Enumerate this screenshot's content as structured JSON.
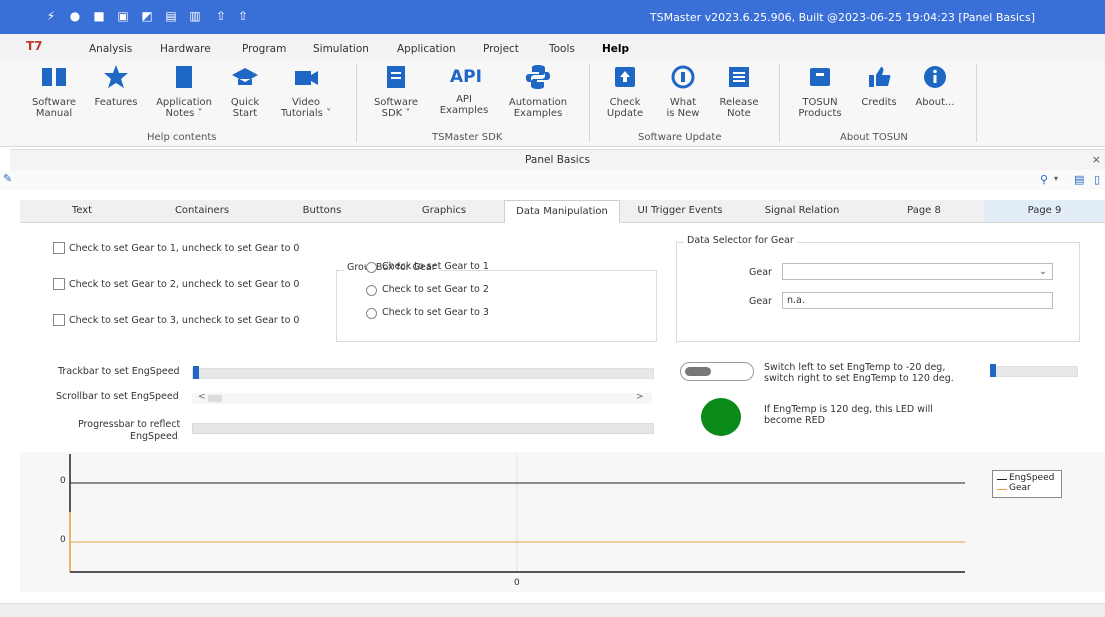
{
  "window": {
    "title": "TSMaster v2023.6.25.906, Built @2023-06-25 19:04:23 [Panel Basics]"
  },
  "menu": [
    "Analysis",
    "Hardware",
    "Program",
    "Simulation",
    "Application",
    "Project",
    "Tools",
    "Help"
  ],
  "ribbon": {
    "groups": [
      {
        "label": "Help contents",
        "buttons": [
          "Software\nManual",
          "Features",
          "Application\nNotes ˅",
          "Quick\nStart",
          "Video\nTutorials ˅"
        ]
      },
      {
        "label": "TSMaster SDK",
        "buttons": [
          "Software\nSDK ˅",
          "API\nExamples",
          "Automation\nExamples"
        ]
      },
      {
        "label": "Software Update",
        "buttons": [
          "Check\nUpdate",
          "What\nis New",
          "Release\nNote"
        ]
      },
      {
        "label": "About TOSUN",
        "buttons": [
          "TOSUN\nProducts",
          "Credits",
          "About..."
        ]
      }
    ],
    "api_icon_text": "API"
  },
  "panel": {
    "title": "Panel Basics"
  },
  "tabs": [
    "Text",
    "Containers",
    "Buttons",
    "Graphics",
    "Data Manipulation",
    "UI Trigger Events",
    "Signal Relation",
    "Page 8",
    "Page 9"
  ],
  "checkboxes": [
    "Check to set Gear to 1, uncheck to set Gear to 0",
    "Check to set Gear to 2, uncheck to set Gear to 0",
    "Check to set Gear to 3, uncheck to set Gear to 0"
  ],
  "groupbox": {
    "title": "GroupBox for Gear",
    "radios": [
      "Check to set Gear to 1",
      "Check to set Gear to 2",
      "Check to set Gear to 3"
    ]
  },
  "selector": {
    "title": "Data Selector for Gear",
    "combo_label": "Gear",
    "combo_value": "",
    "edit_label": "Gear",
    "edit_value": "n.a."
  },
  "controls": {
    "trackbar_label": "Trackbar to set EngSpeed",
    "scrollbar_label": "Scrollbar to set EngSpeed",
    "progress_label_1": "Progressbar to reflect",
    "progress_label_2": "EngSpeed",
    "progress_value": 0,
    "switch_text_1": "Switch left to set EngTemp to -20 deg,",
    "switch_text_2": "switch right to set EngTemp to 120 deg.",
    "led_text_1": "If EngTemp is 120 deg, this LED will",
    "led_text_2": "become RED",
    "led_color": "#0a8a18",
    "scroll_left": "<",
    "scroll_right": ">"
  },
  "chart_data": {
    "type": "line",
    "title": "",
    "series": [
      {
        "name": "EngSpeed",
        "color": "#222222",
        "values": [
          0
        ]
      },
      {
        "name": "Gear",
        "color": "#e8a040",
        "values": [
          0
        ]
      }
    ],
    "y_tick_top": "0",
    "y_tick_bottom": "0",
    "x_tick": "0"
  },
  "colors": {
    "titlebar": "#3a6fd8",
    "accent": "#1e67c4"
  }
}
